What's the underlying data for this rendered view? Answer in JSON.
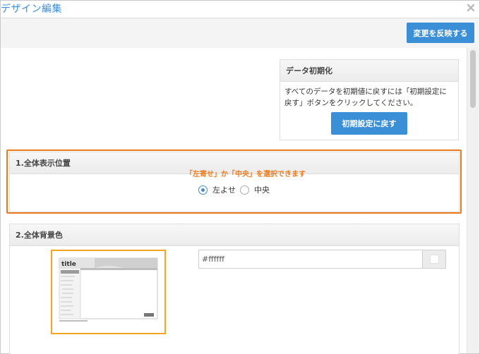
{
  "window": {
    "title": "デザイン編集"
  },
  "toolbar": {
    "apply_label": "変更を反映する"
  },
  "init_panel": {
    "heading": "データ初期化",
    "description": "すべてのデータを初期値に戻すには「初期設定に戻す」ボタンをクリックしてください。",
    "button_label": "初期設定に戻す"
  },
  "position_panel": {
    "heading": "1.全体表示位置",
    "annotation": "「左寄せ」か「中央」を選択できます",
    "options": [
      {
        "label": "左よせ",
        "selected": true
      },
      {
        "label": "中央",
        "selected": false
      }
    ]
  },
  "background_panel": {
    "heading": "2.全体背景色",
    "color_value": "#ffffff"
  },
  "colors": {
    "accent": "#3a8fd6",
    "highlight": "#ec7a1c",
    "preview_border": "#f4a623"
  }
}
